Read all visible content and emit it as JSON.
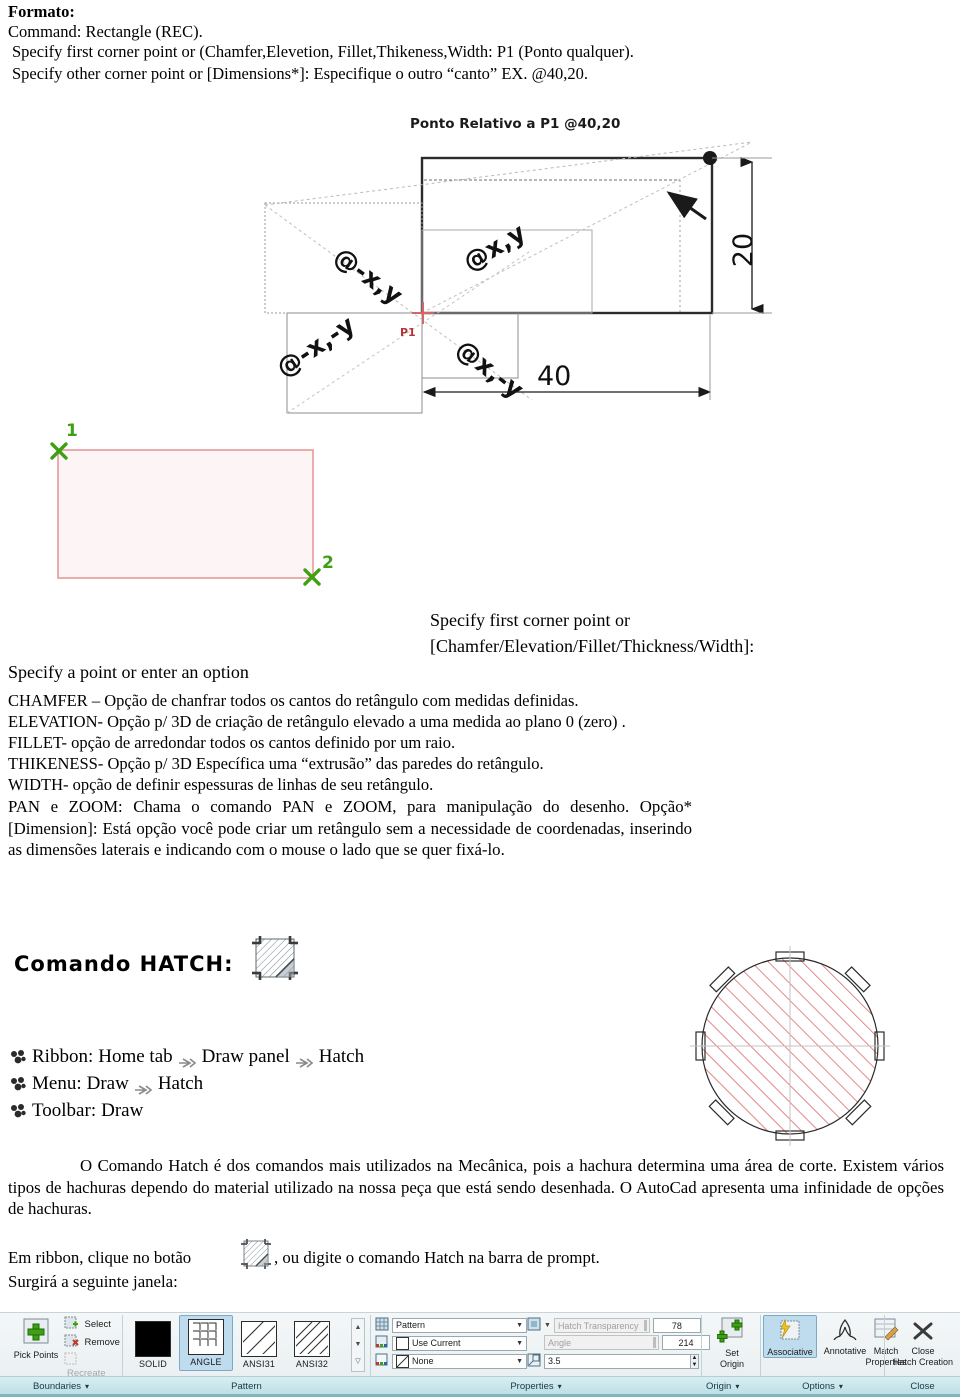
{
  "header": {
    "formato": "Formato:",
    "command": "Command: Rectangle (REC).",
    "line1": "Specify first corner point or (Chamfer,Elevetion, Fillet,Thikeness,Width: P1 (Ponto qualquer).",
    "line2": "Specify other corner point or [Dimensions*]: Especifique o outro “canto” EX. @40,20."
  },
  "drawing": {
    "callout": "Ponto Relativo a P1 @40,20",
    "point_label": "P1",
    "quadrant_q1": "@x,y",
    "quadrant_q2": "@-x,y",
    "quadrant_q3": "@-x,-y",
    "quadrant_q4": "@x,-y",
    "dim_width": "40",
    "dim_height": "20"
  },
  "sketch": {
    "marker_1": "1",
    "marker_2": "2",
    "stroke_color": "#e59a9a",
    "fill_color": "#fdf4f6",
    "marker_color": "#3fa014"
  },
  "prompt": {
    "line_a": "Specify first corner point or",
    "line_b": "[Chamfer/Elevation/Fillet/Thickness/Width]:",
    "line_c": "Specify a point or enter an option"
  },
  "options": [
    "CHAMFER – Opção de chanfrar todos os cantos do retângulo com medidas definidas.",
    "ELEVATION- Opção p/ 3D de criação de retângulo elevado a uma medida ao plano 0 (zero) .",
    "FILLET- opção de arredondar todos os cantos definido por um raio.",
    "THIKENESS- Opção p/ 3D Específica uma “extrusão” das paredes do retângulo.",
    "WIDTH- opção de definir espessuras de linhas de seu retângulo."
  ],
  "paragraph_pan": "PAN e ZOOM: Chama o comando PAN e ZOOM, para manipulação do desenho. Opção* [Dimension]: Está opção você pode criar um retângulo sem a necessidade de coordenadas, inserindo as dimensões laterais e indicando com o mouse o lado que se quer fixá-lo.",
  "hatch": {
    "heading": "Comando HATCH:",
    "access": [
      {
        "label": "Ribbon:",
        "parts": [
          "Home tab",
          "Draw panel",
          "Hatch"
        ]
      },
      {
        "label": "Menu:",
        "parts": [
          "Draw",
          "Hatch"
        ]
      },
      {
        "label": "Toolbar:",
        "parts": [
          "Draw"
        ]
      }
    ],
    "paragraph": "O Comando Hatch é dos comandos mais utilizados na Mecânica, pois a hachura determina uma área de corte. Existem vários tipos de hachuras dependo do material utilizado na nossa peça que está sendo desenhada. O AutoCad apresenta uma infinidade de opções de hachuras.",
    "ribbon_text_before": "Em ribbon, clique no botão",
    "ribbon_text_after": ", ou digite o comando Hatch na barra de prompt.",
    "next_line": "Surgirá a seguinte janela:"
  },
  "ribbon": {
    "panels": [
      {
        "name": "Boundaries",
        "label": "Boundaries",
        "caret": "▾"
      },
      {
        "name": "Pattern",
        "label": "Pattern",
        "caret": ""
      },
      {
        "name": "Properties",
        "label": "Properties",
        "caret": "▾"
      },
      {
        "name": "Origin",
        "label": "Origin",
        "caret": "▾"
      },
      {
        "name": "Options",
        "label": "Options",
        "caret": "▾"
      },
      {
        "name": "Close",
        "label": "Close",
        "caret": ""
      }
    ],
    "boundaries": {
      "pick_points": "Pick Points",
      "select": "Select",
      "remove": "Remove",
      "recreate": "Recreate"
    },
    "patterns": [
      {
        "name": "SOLID",
        "selected": false
      },
      {
        "name": "ANGLE",
        "selected": true
      },
      {
        "name": "ANSI31",
        "selected": false
      },
      {
        "name": "ANSI32",
        "selected": false
      }
    ],
    "properties": {
      "pattern_type": "Pattern",
      "color": "Use Current",
      "background": "None",
      "transparency_label": "Hatch Transparency",
      "transparency_value": "78",
      "angle_label": "Angle",
      "angle_value": "214",
      "scale_value": "3.5"
    },
    "origin": {
      "set_origin": "Set\nOrigin",
      "set_origin_l1": "Set",
      "set_origin_l2": "Origin"
    },
    "options": {
      "associative": "Associative",
      "annotative": "Annotative",
      "match_l1": "Match",
      "match_l2": "Properties",
      "match_caret": "ˇ"
    },
    "close": {
      "l1": "Close",
      "l2": "Hatch Creation"
    },
    "accent_selected": "#bfdcef",
    "accent_band": "#b9dde3"
  }
}
